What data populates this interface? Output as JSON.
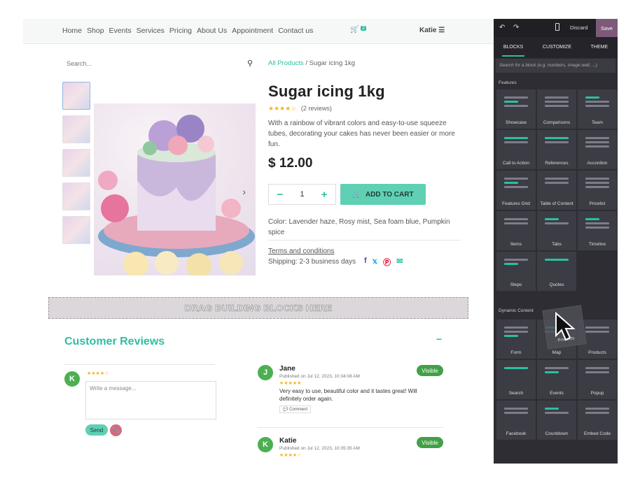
{
  "nav": {
    "links": [
      "Home",
      "Shop",
      "Events",
      "Services",
      "Pricing",
      "About Us",
      "Appointment",
      "Contact us"
    ],
    "cart_count": "2",
    "user": "Katie"
  },
  "search": {
    "placeholder": "Search..."
  },
  "breadcrumb": {
    "parent": "All Products",
    "sep": "/",
    "current": "Sugar icing 1kg"
  },
  "product": {
    "title": "Sugar icing 1kg",
    "stars": "★★★★☆",
    "reviews": "(2 reviews)",
    "description": "With a rainbow of vibrant colors and easy-to-use squeeze tubes, decorating your cakes has never been easier or more fun.",
    "price": "$ 12.00",
    "quantity": "1",
    "qty_minus": "−",
    "qty_plus": "+",
    "add_to_cart": "ADD TO CART",
    "colors": "Color: Lavender haze, Rosy mist, Sea foam blue, Pumpkin spice",
    "terms": "Terms and conditions",
    "shipping": "Shipping: 2-3 business days"
  },
  "dropzone": {
    "label": "DRAG BUILDING BLOCKS HERE"
  },
  "reviews": {
    "title": "Customer Reviews",
    "collapse": "−",
    "my_avatar": "K",
    "my_stars": "★★★★☆",
    "message_placeholder": "Write a message...",
    "send": "Send",
    "items": [
      {
        "avatar": "J",
        "name": "Jane",
        "published": "Published on Jul 12, 2023, 10:34:08 AM",
        "stars": "★★★★★",
        "body": "Very easy to use, beautiful color and it tastes great! Will definitely order again.",
        "comment": "Comment",
        "visible": "Visible"
      },
      {
        "avatar": "K",
        "name": "Katie",
        "published": "Published on Jul 12, 2023, 10:35:35 AM",
        "stars": "★★★★☆",
        "visible": "Visible"
      }
    ]
  },
  "editor": {
    "discard": "Discard",
    "save": "Save",
    "tabs": [
      "BLOCKS",
      "CUSTOMIZE",
      "THEME"
    ],
    "search_placeholder": "Search for a block (e.g. numbers, image wall, ...)",
    "features_title": "Features",
    "features": [
      "Showcase",
      "Comparisons",
      "Team",
      "Call to Action",
      "References",
      "Accordion",
      "Features Grid",
      "Table of Content",
      "Pricelist",
      "Items",
      "Tabs",
      "Timeline",
      "Steps",
      "Quotes"
    ],
    "dynamic_title": "Dynamic Content",
    "dynamic": [
      "Form",
      "Map",
      "Products",
      "Search",
      "Events",
      "Popup",
      "Facebook",
      "Countdown",
      "Embed Code"
    ],
    "dragging": "Products"
  },
  "colors": {
    "accent": "#2bbfa0",
    "panel_bg": "#2d2d33",
    "save_bg": "#7d5a7a"
  }
}
